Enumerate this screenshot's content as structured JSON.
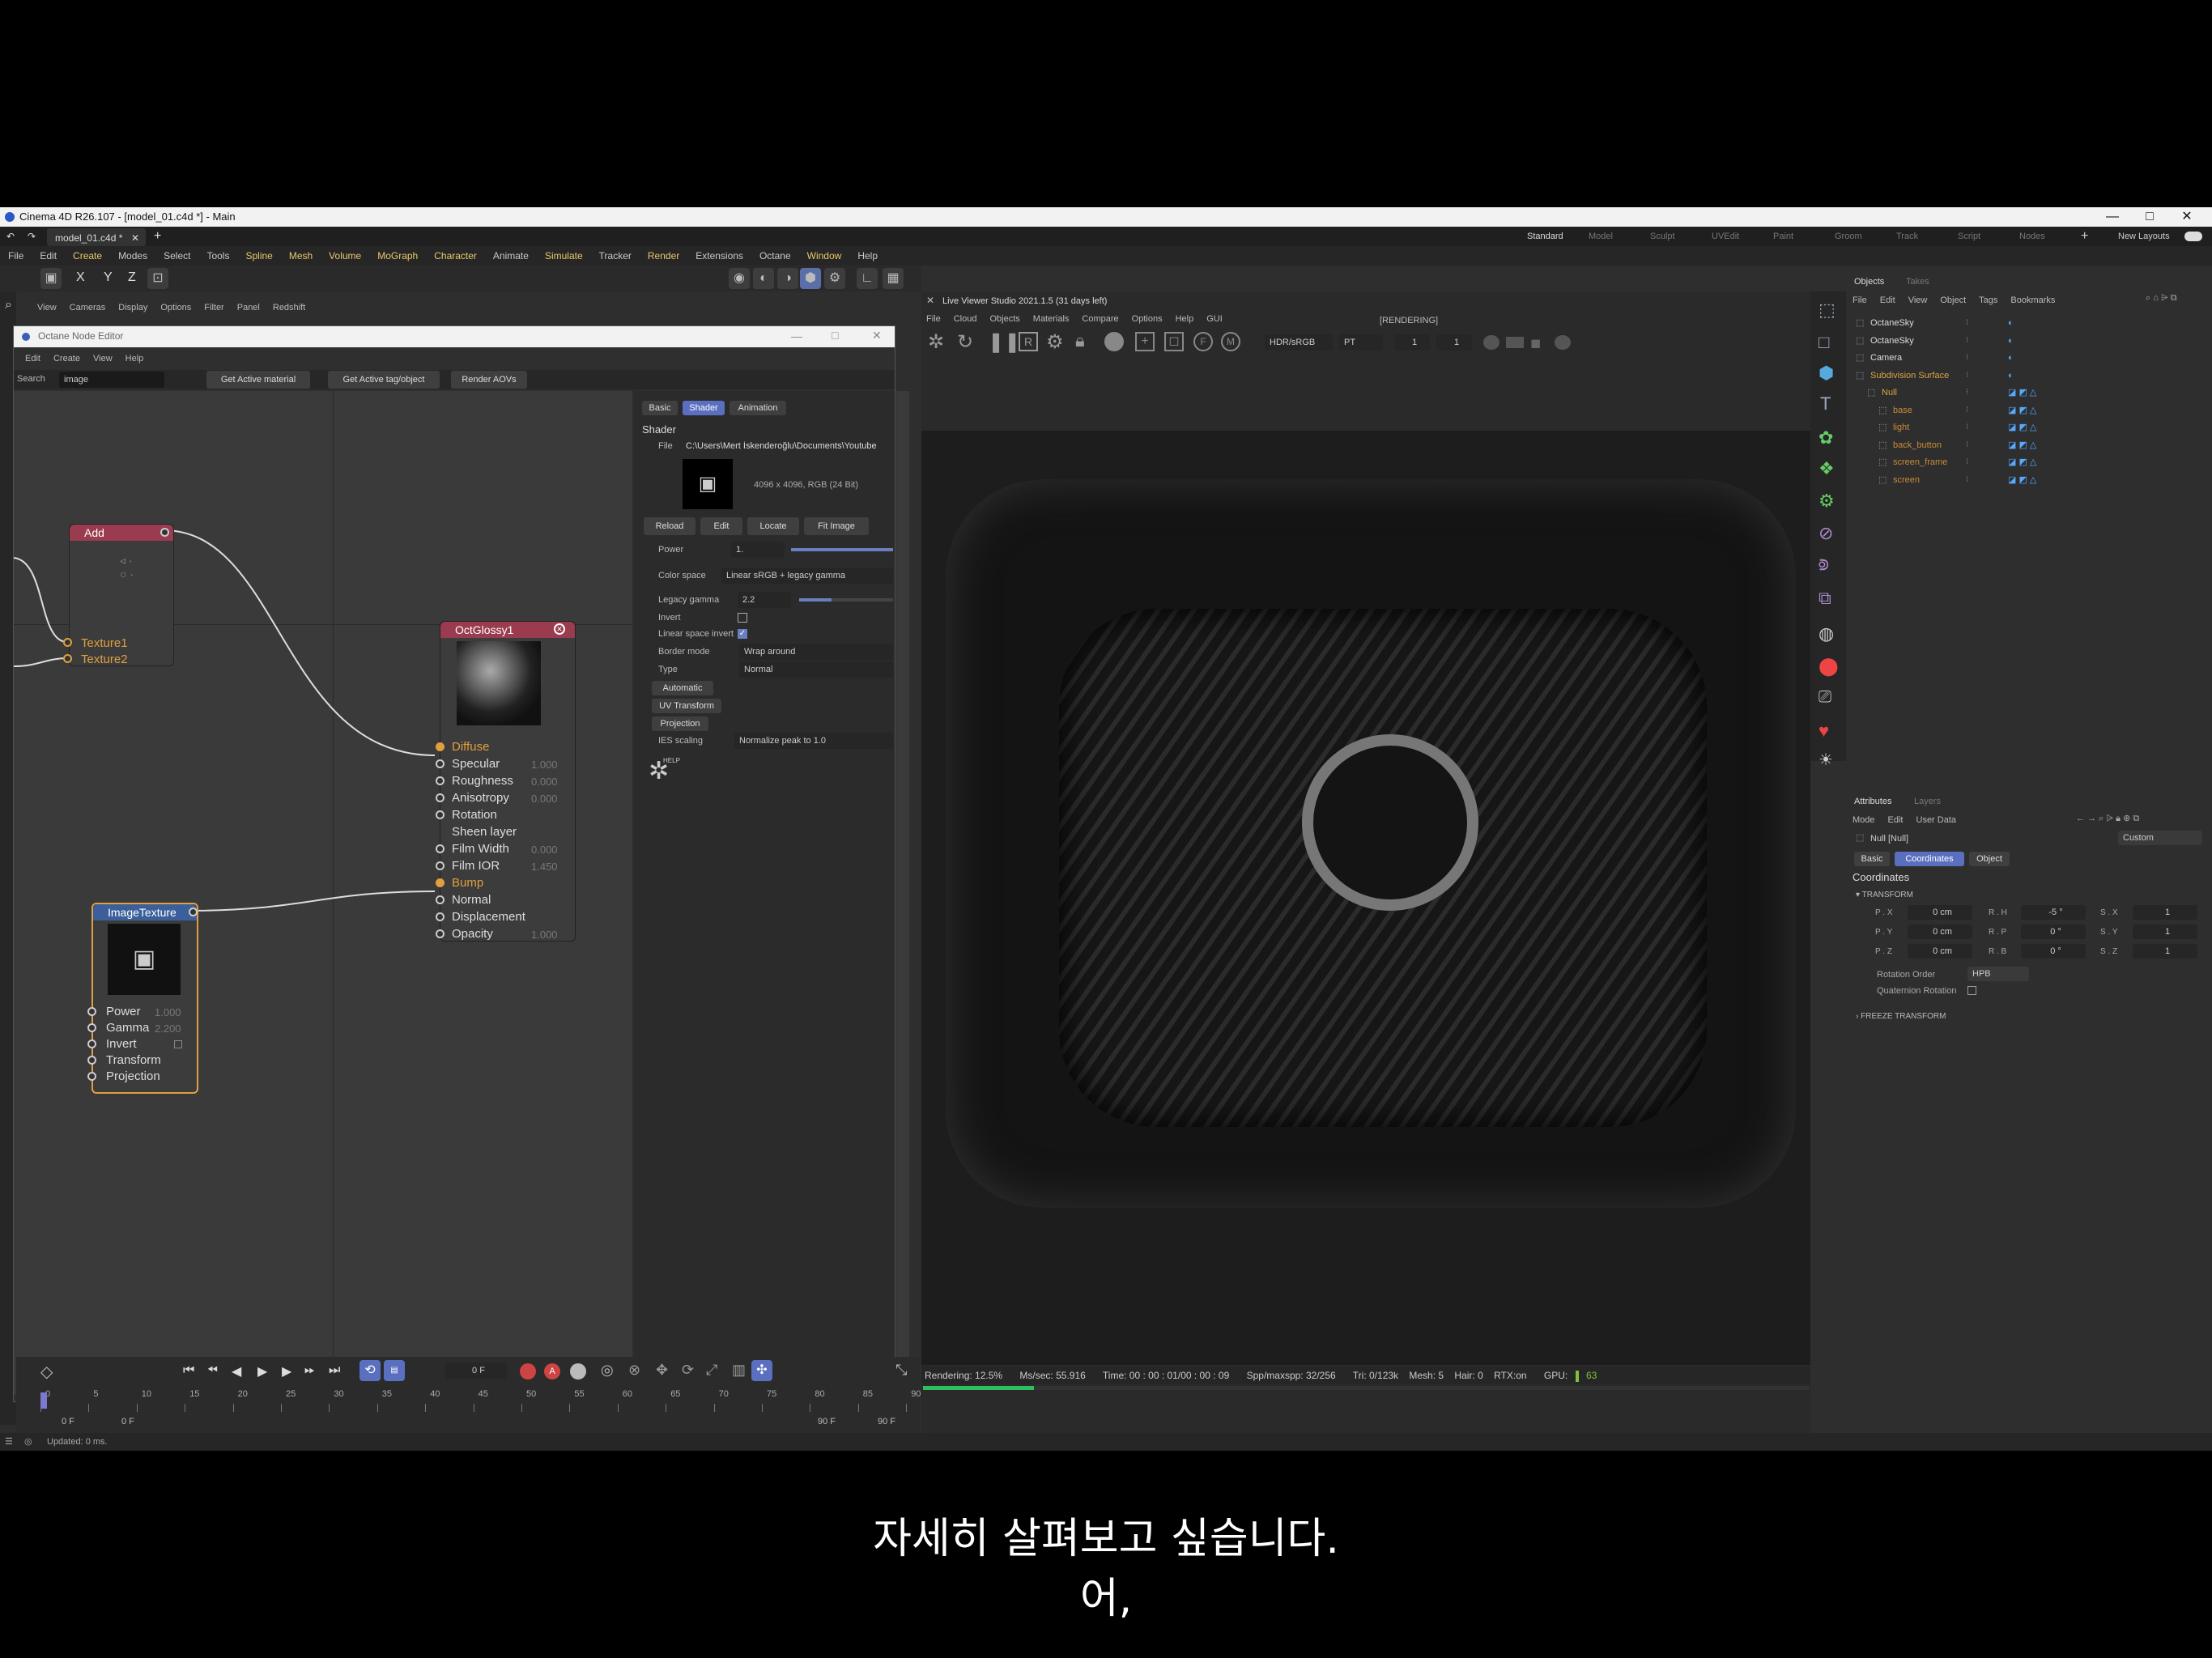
{
  "app": {
    "title": "Cinema 4D R26.107 - [model_01.c4d *] - Main",
    "doc_tab": "model_01.c4d *"
  },
  "layouts": [
    "Standard",
    "Model",
    "Sculpt",
    "UVEdit",
    "Paint",
    "Groom",
    "Track",
    "Script",
    "Nodes"
  ],
  "new_layouts": "New Layouts",
  "menu": [
    "File",
    "Edit",
    "Create",
    "Modes",
    "Select",
    "Tools",
    "Spline",
    "Mesh",
    "Volume",
    "MoGraph",
    "Character",
    "Animate",
    "Simulate",
    "Tracker",
    "Render",
    "Extensions",
    "Octane",
    "Window",
    "Help"
  ],
  "viewport_menu": [
    "View",
    "Cameras",
    "Display",
    "Options",
    "Filter",
    "Panel",
    "Redshift"
  ],
  "axes": [
    "X",
    "Y",
    "Z"
  ],
  "node_editor": {
    "title": "Octane Node Editor",
    "menu": [
      "Edit",
      "Create",
      "View",
      "Help"
    ],
    "search_label": "Search",
    "search_value": "image",
    "buttons": [
      "Get Active material",
      "Get Active tag/object",
      "Render AOVs"
    ],
    "add_node": {
      "title": "Add",
      "ports": [
        "Texture1",
        "Texture2"
      ]
    },
    "glossy_node": {
      "title": "OctGlossy1",
      "ports": [
        {
          "name": "Diffuse",
          "value": ""
        },
        {
          "name": "Specular",
          "value": "1.000"
        },
        {
          "name": "Roughness",
          "value": "0.000"
        },
        {
          "name": "Anisotropy",
          "value": "0.000"
        },
        {
          "name": "Rotation",
          "value": ""
        },
        {
          "name": "Sheen layer",
          "value": ""
        },
        {
          "name": "Film Width",
          "value": "0.000"
        },
        {
          "name": "Film IOR",
          "value": "1.450"
        },
        {
          "name": "Bump",
          "value": ""
        },
        {
          "name": "Normal",
          "value": ""
        },
        {
          "name": "Displacement",
          "value": ""
        },
        {
          "name": "Opacity",
          "value": "1.000"
        }
      ]
    },
    "image_node": {
      "title": "ImageTexture",
      "ports": [
        {
          "name": "Power",
          "value": "1.000"
        },
        {
          "name": "Gamma",
          "value": "2.200"
        },
        {
          "name": "Invert",
          "value": ""
        },
        {
          "name": "Transform",
          "value": ""
        },
        {
          "name": "Projection",
          "value": ""
        }
      ]
    },
    "tabs": [
      "Basic",
      "Shader",
      "Animation"
    ],
    "shader": {
      "heading": "Shader",
      "file_label": "File",
      "file_path": "C:\\Users\\Mert İskenderoğlu\\Documents\\Youtube",
      "image_info": "4096 x 4096, RGB (24 Bit)",
      "buttons": [
        "Reload",
        "Edit",
        "Locate",
        "Fit Image"
      ],
      "power_label": "Power",
      "power_value": "1.",
      "colorspace_label": "Color space",
      "colorspace_value": "Linear sRGB + legacy gamma",
      "legacy_label": "Legacy gamma",
      "legacy_value": "2.2",
      "invert_label": "Invert",
      "linear_label": "Linear space invert",
      "border_label": "Border mode",
      "border_value": "Wrap around",
      "type_label": "Type",
      "type_value": "Normal",
      "sub_buttons": [
        "Automatic",
        "UV Transform",
        "Projection"
      ],
      "ies_label": "IES scaling",
      "ies_value": "Normalize peak to 1.0",
      "help": "HELP"
    }
  },
  "live_viewer": {
    "title": "Live Viewer Studio 2021.1.5 (31 days left)",
    "menu": [
      "File",
      "Cloud",
      "Objects",
      "Materials",
      "Compare",
      "Options",
      "Help",
      "GUI"
    ],
    "status": "[RENDERING]",
    "mode": "HDR/sRGB",
    "kernel": "PT",
    "val1": "1",
    "val2": "1",
    "stats": {
      "rendering": "Rendering: 12.5%",
      "mssec": "Ms/sec: 55.916",
      "time": "Time: 00 : 00 : 01/00 : 00 : 09",
      "spp": "Spp/maxspp: 32/256",
      "tri": "Tri: 0/123k",
      "mesh": "Mesh: 5",
      "hair": "Hair: 0",
      "rtx": "RTX:on",
      "gpu": "GPU:",
      "gpu_val": "63"
    },
    "progress": 0.125
  },
  "timeline": {
    "frame": "0 F",
    "start": "0 F",
    "start2": "0 F",
    "end": "90 F",
    "end2": "90 F",
    "ticks": [
      "0",
      "5",
      "10",
      "15",
      "20",
      "25",
      "30",
      "35",
      "40",
      "45",
      "50",
      "55",
      "60",
      "65",
      "70",
      "75",
      "80",
      "85",
      "90"
    ]
  },
  "status_bar": "Updated: 0 ms.",
  "objects": {
    "tabs": [
      "Objects",
      "Takes"
    ],
    "menu": [
      "File",
      "Edit",
      "View",
      "Object",
      "Tags",
      "Bookmarks"
    ],
    "items": [
      {
        "name": "OctaneSky",
        "indent": 0,
        "color": "#dddddd"
      },
      {
        "name": "OctaneSky",
        "indent": 0,
        "color": "#dddddd"
      },
      {
        "name": "Camera",
        "indent": 0,
        "color": "#dddddd"
      },
      {
        "name": "Subdivision Surface",
        "indent": 0,
        "color": "#d9a441"
      },
      {
        "name": "Null",
        "indent": 1,
        "color": "#d9a441"
      },
      {
        "name": "base",
        "indent": 2,
        "color": "#c98a3a"
      },
      {
        "name": "light",
        "indent": 2,
        "color": "#c98a3a"
      },
      {
        "name": "back_button",
        "indent": 2,
        "color": "#c98a3a"
      },
      {
        "name": "screen_frame",
        "indent": 2,
        "color": "#c98a3a"
      },
      {
        "name": "screen",
        "indent": 2,
        "color": "#c98a3a"
      }
    ]
  },
  "attributes": {
    "tabs": [
      "Attributes",
      "Layers"
    ],
    "menu": [
      "Mode",
      "Edit",
      "User Data"
    ],
    "object": "Null [Null]",
    "preset": "Custom",
    "subtabs": [
      "Basic",
      "Coordinates",
      "Object"
    ],
    "section": "Coordinates",
    "transform": "TRANSFORM",
    "coords": [
      {
        "l1": "P . X",
        "v1": "0 cm",
        "l2": "R . H",
        "v2": "-5 °",
        "l3": "S . X",
        "v3": "1"
      },
      {
        "l1": "P . Y",
        "v1": "0 cm",
        "l2": "R . P",
        "v2": "0 °",
        "l3": "S . Y",
        "v3": "1"
      },
      {
        "l1": "P . Z",
        "v1": "0 cm",
        "l2": "R . B",
        "v2": "0 °",
        "l3": "S . Z",
        "v3": "1"
      }
    ],
    "rot_order_label": "Rotation Order",
    "rot_order": "HPB",
    "quat_label": "Quaternion Rotation",
    "freeze": "FREEZE TRANSFORM"
  },
  "subtitles": [
    "자세히 살펴보고 싶습니다.",
    "어,"
  ]
}
